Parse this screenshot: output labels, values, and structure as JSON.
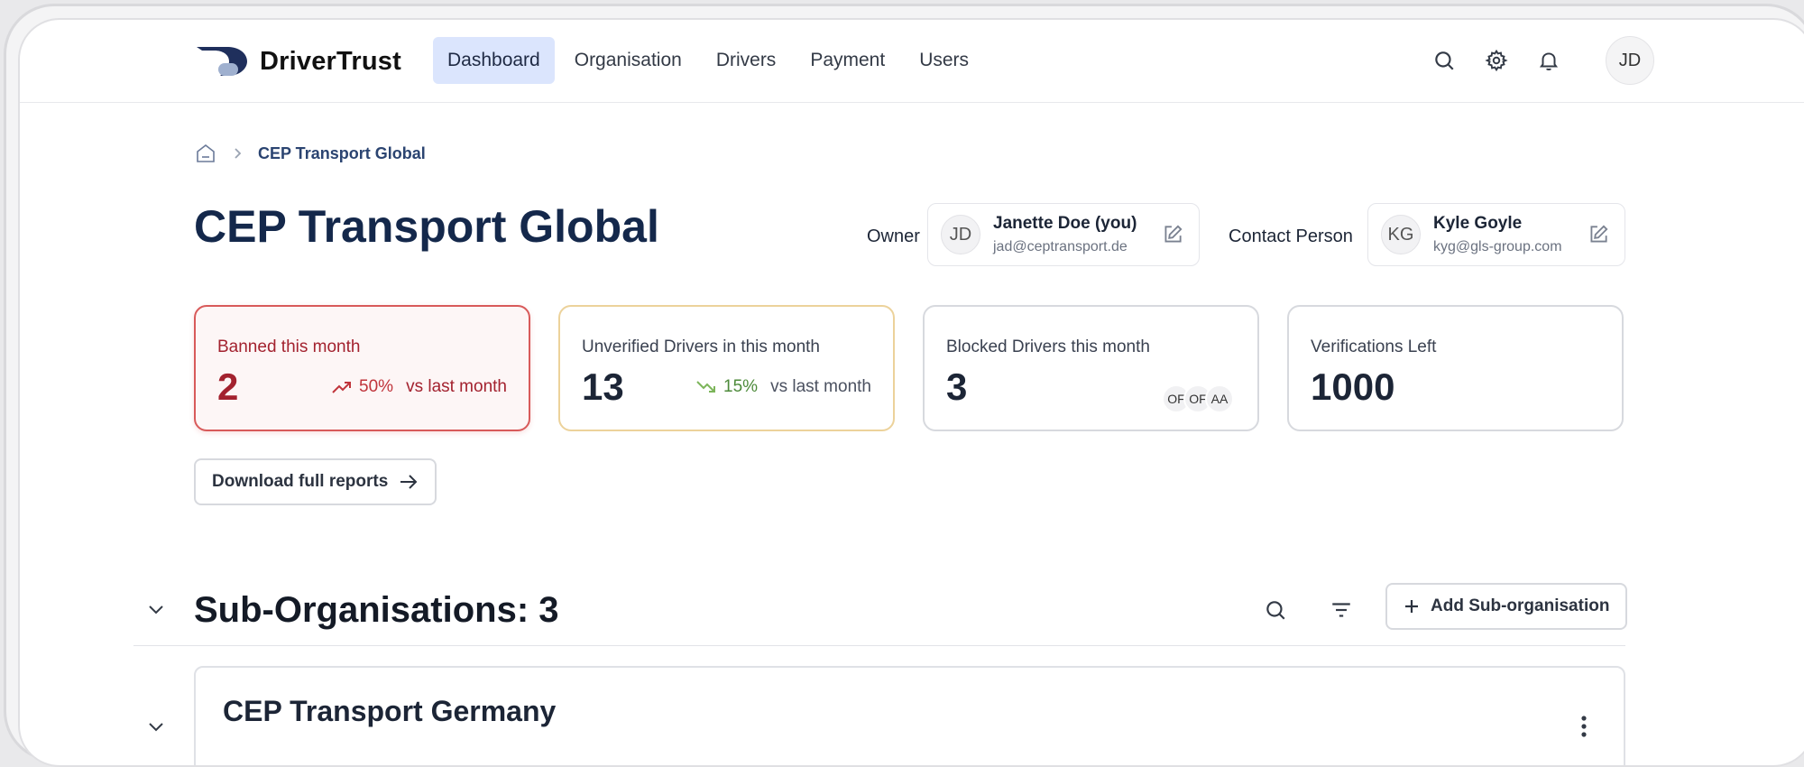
{
  "brand": {
    "name": "DriverTrust"
  },
  "nav": {
    "items": [
      {
        "label": "Dashboard",
        "active": true
      },
      {
        "label": "Organisation"
      },
      {
        "label": "Drivers"
      },
      {
        "label": "Payment"
      },
      {
        "label": "Users"
      }
    ]
  },
  "user": {
    "initials": "JD"
  },
  "breadcrumb": {
    "current": "CEP Transport Global"
  },
  "page": {
    "title": "CEP Transport Global"
  },
  "owner": {
    "label": "Owner",
    "initials": "JD",
    "name": "Janette Doe (you)",
    "email": "jad@ceptransport.de"
  },
  "contact": {
    "label": "Contact Person",
    "initials": "KG",
    "name": "Kyle Goyle",
    "email": "kyg@gls-group.com"
  },
  "stats": [
    {
      "label": "Banned this month",
      "value": "2",
      "trend": "50%",
      "trend_note": "vs last month"
    },
    {
      "label": "Unverified Drivers in this month",
      "value": "13",
      "trend": "15%",
      "trend_note": "vs last month"
    },
    {
      "label": "Blocked Drivers this month",
      "value": "3",
      "avatars": [
        "OF",
        "OF",
        "AA"
      ]
    },
    {
      "label": "Verifications Left",
      "value": "1000"
    }
  ],
  "actions": {
    "download": "Download full reports",
    "add_suborg": "Add Sub-organisation"
  },
  "suborgs": {
    "title": "Sub-Organisations: 3",
    "items": [
      {
        "name": "CEP Transport Germany"
      }
    ]
  },
  "colors": {
    "brand_navy": "#1f2f5c",
    "nav_active_bg": "#dbe5fd",
    "danger": "#a3222f",
    "trend_up": "#c0343b",
    "trend_down": "#4d8a3a",
    "warn_border": "#ecd29b"
  }
}
